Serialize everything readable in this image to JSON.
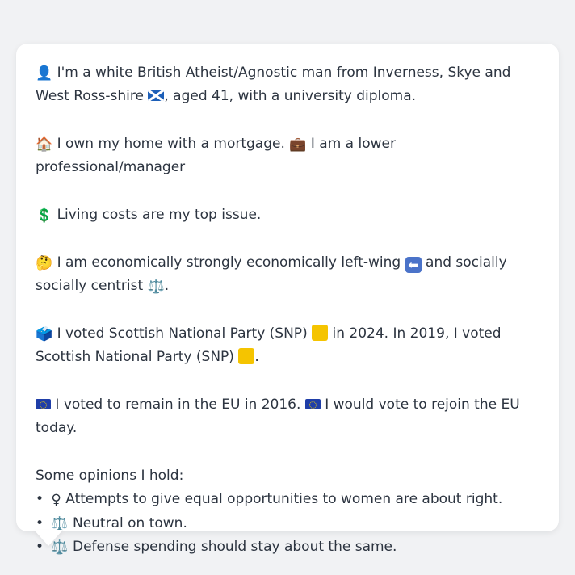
{
  "profile": {
    "identity": {
      "icon": "person-silhouette-icon",
      "text_a": "I'm a white British Atheist/Agnostic man from Inverness, Skye and West Ross-shire",
      "flag": "scotland-flag-icon",
      "text_b": ", aged 41, with a university diploma."
    },
    "home": {
      "icon": "house-icon",
      "text": "I own my home with a mortgage.",
      "job_icon": "briefcase-icon",
      "job_text": "I am a lower professional/manager"
    },
    "issue": {
      "icon": "dollar-icon",
      "text": "Living costs are my top issue."
    },
    "ideology": {
      "icon": "thinking-face-icon",
      "text_a": "I am economically strongly economically left-wing",
      "arrow_icon": "left-arrow-icon",
      "text_b": "and socially socially centrist",
      "scales_icon": "balance-scale-icon",
      "text_c": "."
    },
    "votes": {
      "icon": "ballot-box-icon",
      "text_a": "I voted Scottish National Party (SNP)",
      "party_color_icon": "yellow-square-icon",
      "text_b": "in 2024. In 2019, I voted Scottish National Party (SNP)",
      "text_c": "."
    },
    "eu": {
      "icon": "eu-flag-icon",
      "text_a": "I voted to remain in the EU in 2016.",
      "text_b": "I would vote to rejoin the EU today."
    },
    "opinions": {
      "heading": "Some opinions I hold:",
      "items": [
        {
          "icon": "female-sign-icon",
          "glyph": "♀",
          "text": "Attempts to give equal opportunities to women are about right."
        },
        {
          "icon": "balance-scale-icon",
          "glyph": "⚖️",
          "text": "Neutral on town."
        },
        {
          "icon": "balance-scale-icon",
          "glyph": "⚖️",
          "text": "Defense spending should stay about the same."
        }
      ]
    }
  },
  "colors": {
    "background": "#f1f2f4",
    "bubble": "#ffffff",
    "text": "#2c3440",
    "snp_yellow": "#f5c400",
    "eu_blue": "#1f3ea8"
  }
}
